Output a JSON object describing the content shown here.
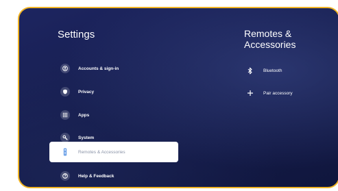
{
  "settings": {
    "title": "Settings",
    "items": [
      {
        "label": "Accounts & sign-in",
        "icon": "account-icon"
      },
      {
        "label": "Privacy",
        "icon": "shield-icon"
      },
      {
        "label": "Apps",
        "icon": "apps-grid-icon"
      },
      {
        "label": "System",
        "icon": "system-wrench-icon"
      },
      {
        "label": "Remotes & Accessories",
        "icon": "remote-icon",
        "selected": true
      },
      {
        "label": "Help & Feedback",
        "icon": "help-icon"
      }
    ]
  },
  "detail": {
    "title": "Remotes & Accessories",
    "items": [
      {
        "label": "Bluetooth",
        "icon": "bluetooth-icon"
      },
      {
        "label": "Pair accessory",
        "icon": "plus-icon"
      }
    ]
  },
  "colors": {
    "frame_border": "#f0b323",
    "background": "#161d4f",
    "selected_bg": "#ffffff",
    "selected_text": "#8a93a7"
  }
}
